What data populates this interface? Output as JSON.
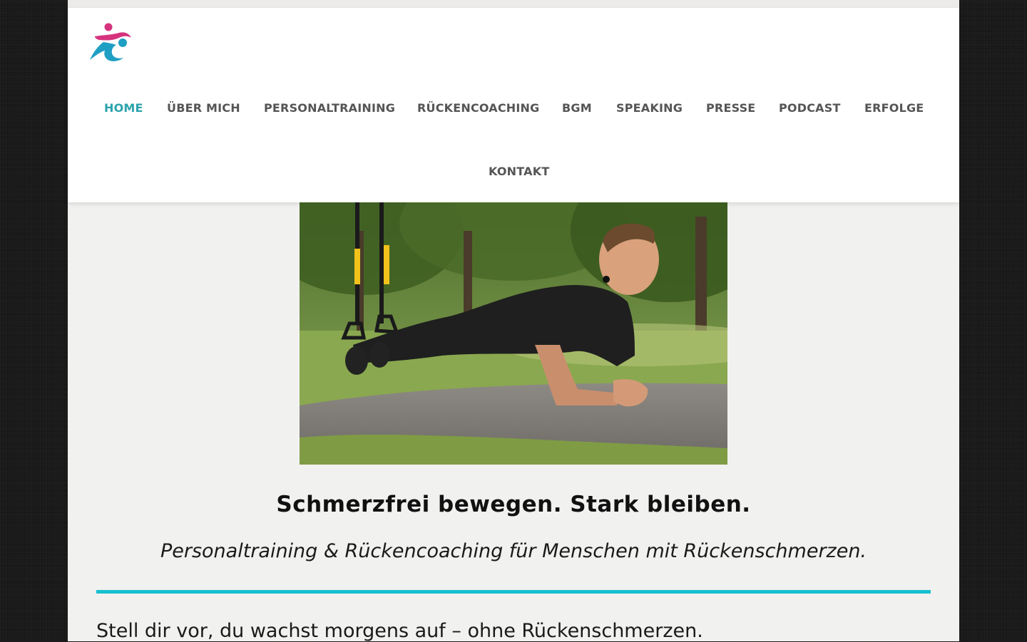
{
  "nav": {
    "items": [
      {
        "label": "HOME",
        "active": true
      },
      {
        "label": "ÜBER MICH"
      },
      {
        "label": "PERSONALTRAINING"
      },
      {
        "label": "RÜCKENCOACHING"
      },
      {
        "label": "BGM"
      },
      {
        "label": "SPEAKING"
      },
      {
        "label": "PRESSE"
      },
      {
        "label": "PODCAST"
      },
      {
        "label": "ERFOLGE"
      },
      {
        "label": "KONTAKT"
      }
    ]
  },
  "hero": {
    "headline": "Schmerzfrei bewegen. Stark bleiben.",
    "subline": "Personaltraining & Rückencoaching für Menschen mit Rückenschmerzen."
  },
  "content": {
    "intro": "Stell dir vor, du wachst morgens auf – ohne Rückenschmerzen."
  },
  "colors": {
    "accent": "#2ba3ad",
    "divider": "#17c0cf",
    "logo_pink": "#d6337e",
    "logo_teal": "#1f9fc4"
  }
}
